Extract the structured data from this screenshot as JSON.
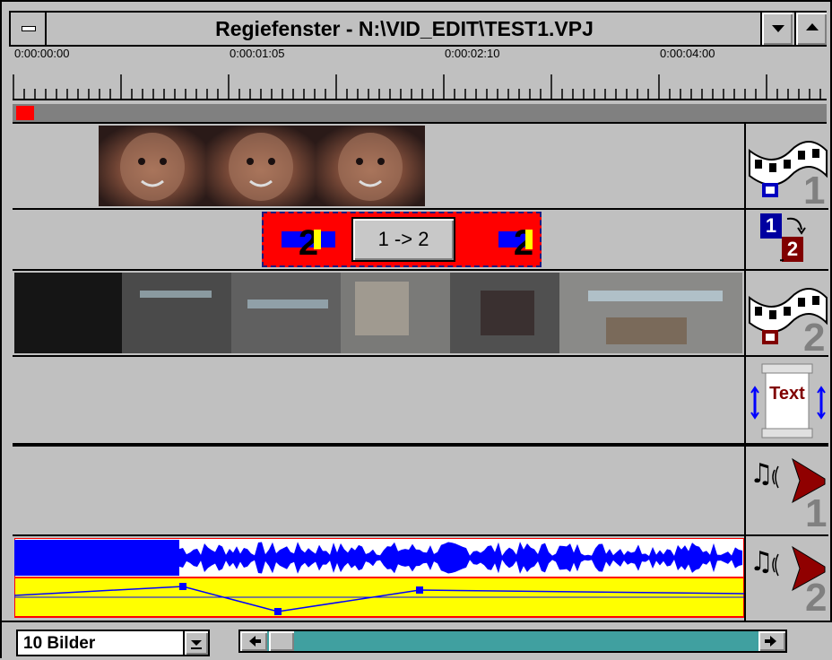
{
  "window": {
    "title": "Regiefenster - N:\\VID_EDIT\\TEST1.VPJ"
  },
  "timeline": {
    "timecodes": [
      "0:00:00:00",
      "0:00:01:05",
      "0:00:02:10",
      "0:00:04:00"
    ]
  },
  "tracks": {
    "video1": {
      "number": "1"
    },
    "transition": {
      "label": "1 -> 2",
      "marker": "2",
      "badge_a": "1",
      "badge_b": "2"
    },
    "video2": {
      "number": "2"
    },
    "text": {
      "label": "Text"
    },
    "audio1": {
      "number": "1"
    },
    "audio2": {
      "number": "2"
    }
  },
  "bottom": {
    "zoom_select": "10 Bilder"
  },
  "colors": {
    "waveform": "#0000ff",
    "volume_bg": "#ffff00",
    "transition_bg": "#ff0000",
    "scroll_track": "#40a0a0"
  }
}
